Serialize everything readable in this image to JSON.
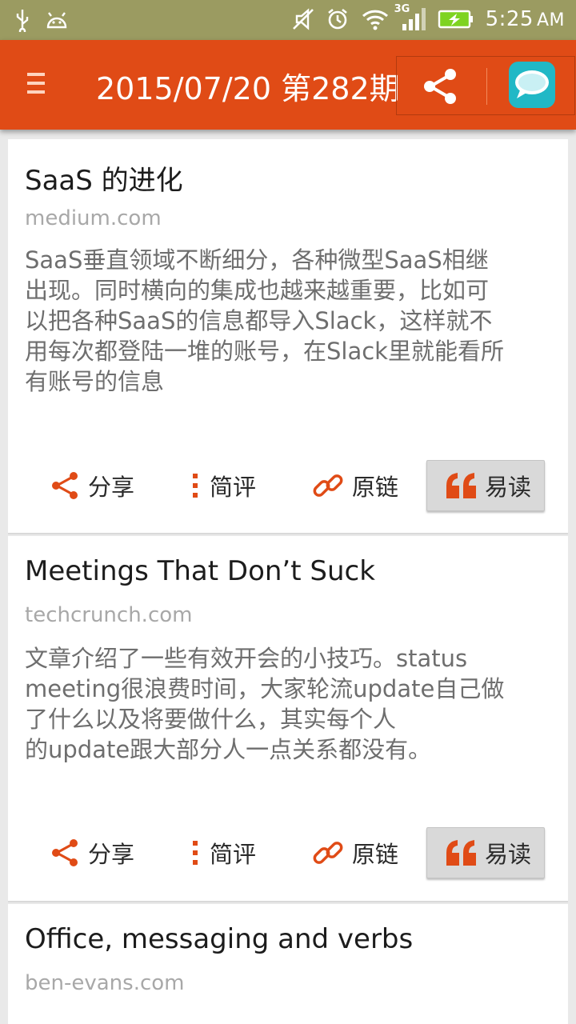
{
  "status_bar": {
    "time": "5:25",
    "ampm": "AM",
    "network": "3G",
    "icons": [
      "usb-icon",
      "android-icon",
      "mute-icon",
      "alarm-icon",
      "wifi-icon",
      "signal-icon",
      "battery-charging-icon"
    ]
  },
  "toolbar": {
    "title": "2015/07/20 第282期",
    "menu_icon": "hamburger-icon",
    "share_icon": "share-icon",
    "chat_icon": "chat-bubble-icon"
  },
  "colors": {
    "accent": "#e04b16",
    "statusbar": "#9b9b61",
    "chat": "#21b8c6"
  },
  "actions": {
    "share": "分享",
    "comment": "简评",
    "link": "原链",
    "read": "易读"
  },
  "articles": [
    {
      "title": "SaaS 的进化",
      "source": "medium.com",
      "summary": [
        "SaaS垂直领域不断细分，各种微型SaaS相继",
        "出现。同时横向的集成也越来越重要，比如可",
        "以把各种SaaS的信息都导入Slack，这样就不",
        "用每次都登陆一堆的账号，在Slack里就能看所",
        "有账号的信息"
      ]
    },
    {
      "title": "Meetings That Don’t Suck",
      "source": "techcrunch.com",
      "summary": [
        "文章介绍了一些有效开会的小技巧。status",
        "meeting很浪费时间，大家轮流update自己做",
        "了什么以及将要做什么，其实每个人",
        "的update跟大部分人一点关系都没有。"
      ]
    },
    {
      "title": "Office, messaging and verbs",
      "source": "ben-evans.com",
      "summary": []
    }
  ]
}
